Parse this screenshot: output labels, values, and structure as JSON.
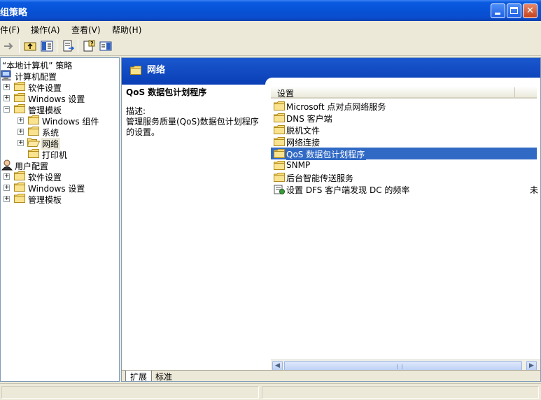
{
  "window": {
    "title": "组策略"
  },
  "menu": [
    {
      "label": "件(F)"
    },
    {
      "label": "操作(A)"
    },
    {
      "label": "查看(V)"
    },
    {
      "label": "帮助(H)"
    }
  ],
  "tree": {
    "root": "“本地计算机” 策略",
    "computer_config": "计算机配置",
    "software_settings": "软件设置",
    "windows_settings": "Windows 设置",
    "admin_templates": "管理模板",
    "windows_components": "Windows 组件",
    "system": "系统",
    "network": "网络",
    "printers": "打印机",
    "user_config": "用户配置",
    "user_software_settings": "软件设置",
    "user_windows_settings": "Windows 设置",
    "user_admin_templates": "管理模板"
  },
  "right": {
    "header_title": "网络",
    "desc_title": "QoS 数据包计划程序",
    "desc_label": "描述:",
    "desc_text": "管理服务质量(QoS)数据包计划程序的设置。",
    "column_header": "设置",
    "items": [
      {
        "label": "Microsoft 点对点网络服务",
        "icon": "folder-icon"
      },
      {
        "label": "DNS 客户端",
        "icon": "folder-icon"
      },
      {
        "label": "脱机文件",
        "icon": "folder-icon"
      },
      {
        "label": "网络连接",
        "icon": "folder-icon"
      },
      {
        "label": "QoS 数据包计划程序",
        "icon": "folder-icon",
        "selected": true
      },
      {
        "label": "SNMP",
        "icon": "folder-icon"
      },
      {
        "label": "后台智能传送服务",
        "icon": "folder-icon"
      },
      {
        "label": "设置 DFS 客户端发现 DC 的频率",
        "icon": "policy-setting-icon",
        "extra": "未"
      }
    ],
    "tabs": [
      {
        "label": "扩展",
        "active": true
      },
      {
        "label": "标准",
        "active": false
      }
    ]
  },
  "colors": {
    "titlebar": "#0752d6",
    "header_band": "#1a57ce",
    "selection": "#316ac5",
    "folder": "#f5d76e"
  }
}
